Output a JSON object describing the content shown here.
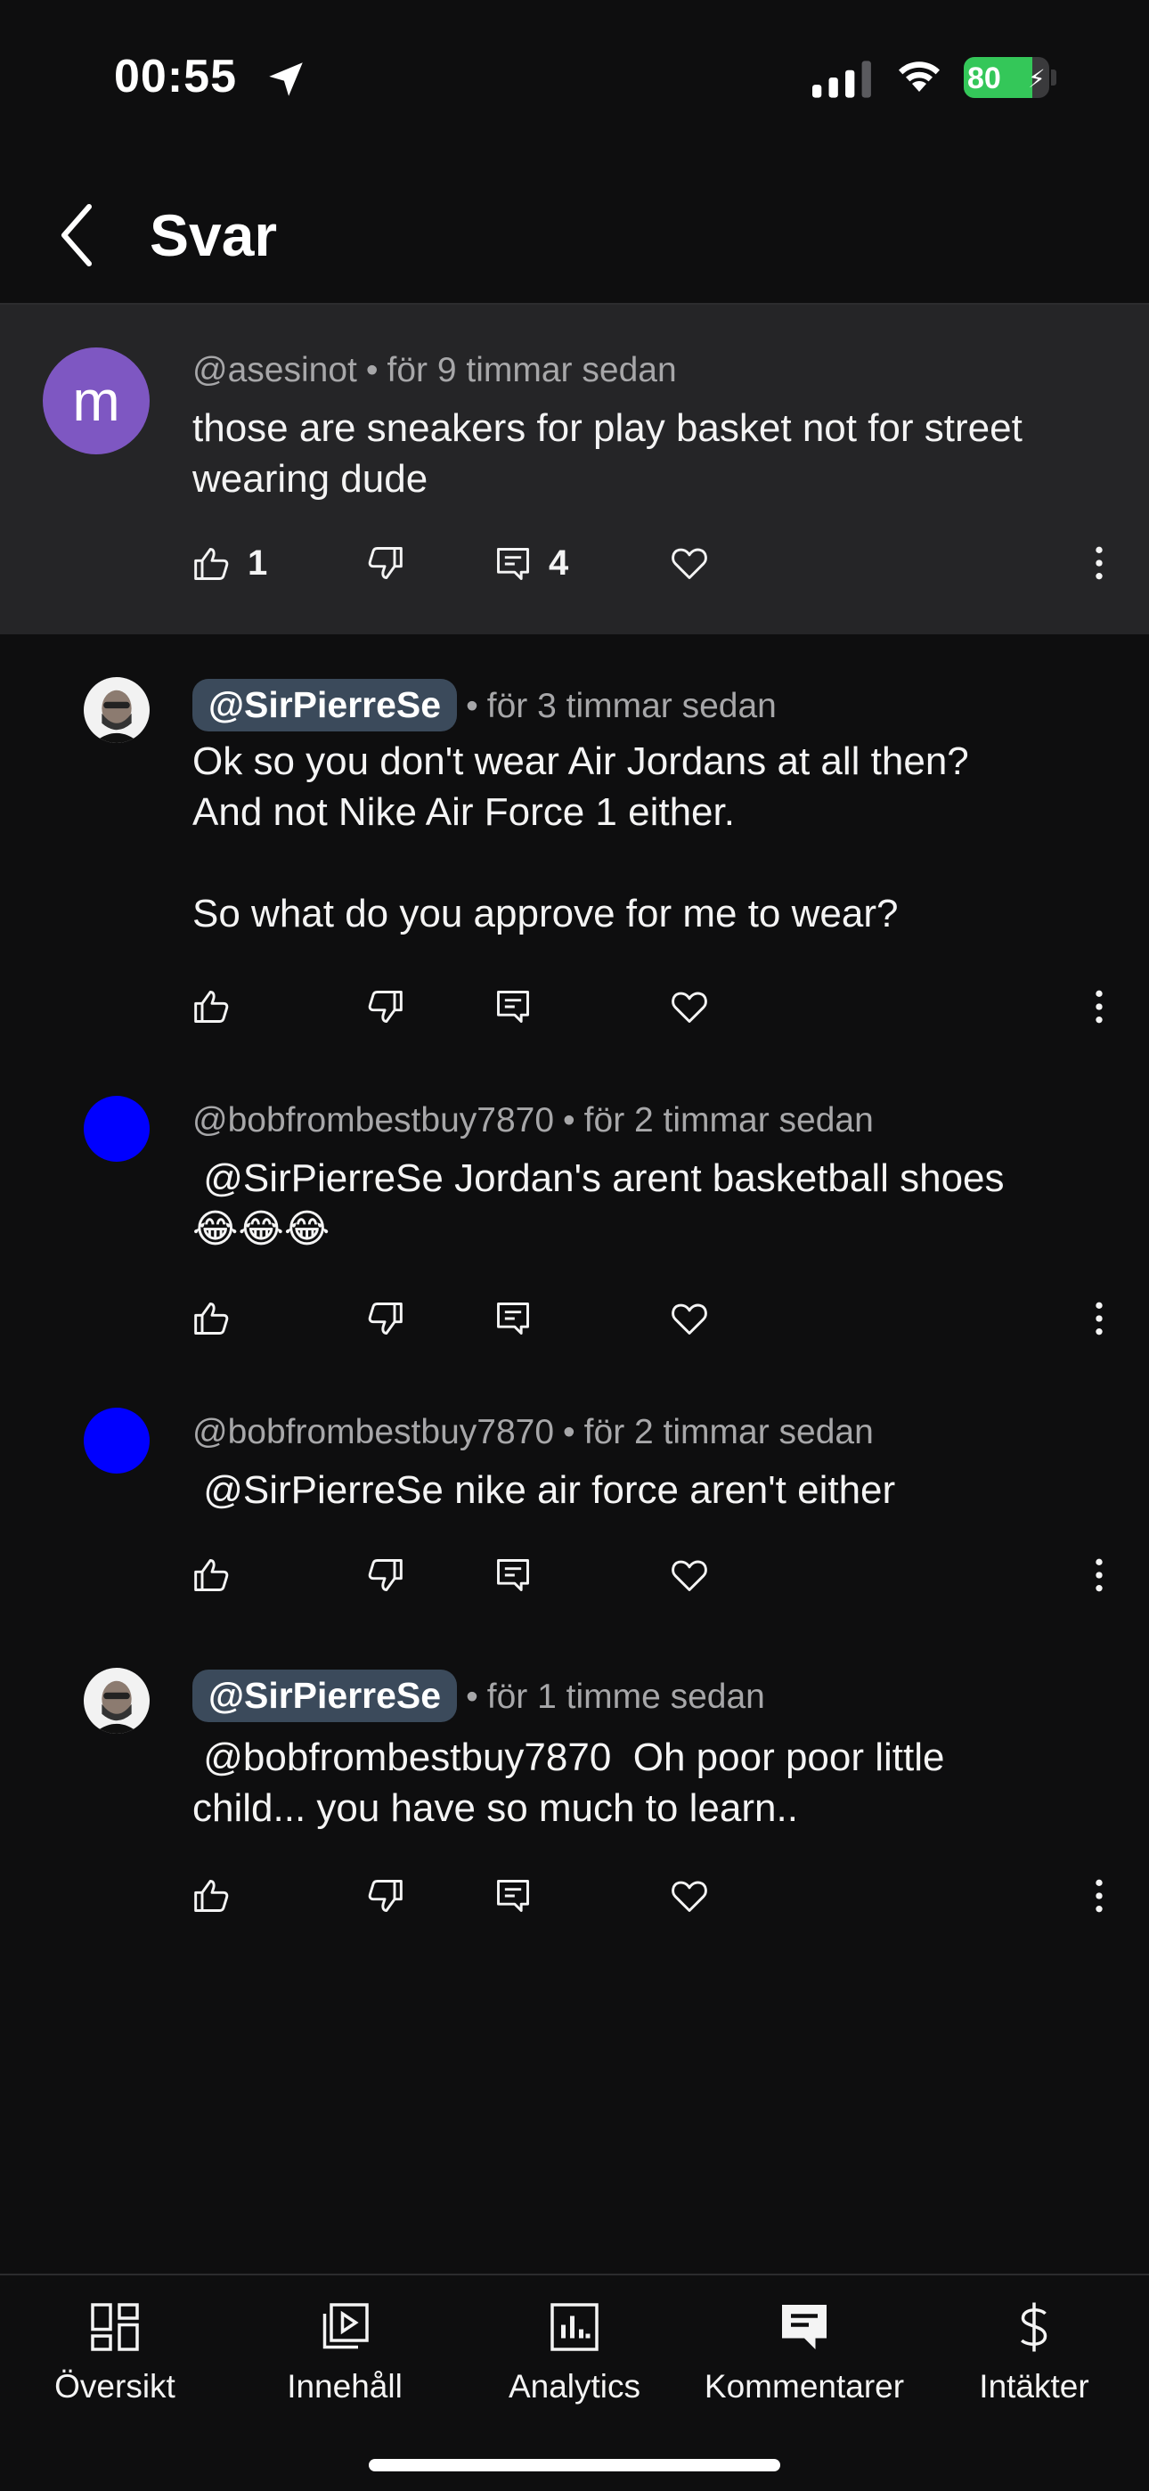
{
  "status_bar": {
    "time": "00:55",
    "battery": "80",
    "battery_level": 80
  },
  "header": {
    "title": "Svar"
  },
  "comments": [
    {
      "handle": "@asesinot",
      "handle_style": "plain",
      "avatar": {
        "type": "letter",
        "letter": "m",
        "color": "#7e57c2"
      },
      "time": "för 9 timmar sedan",
      "text": "those are sneakers for play basket not for street wearing dude",
      "likes": "1",
      "replies": "4"
    },
    {
      "handle": "@SirPierreSe",
      "handle_style": "chip",
      "avatar": {
        "type": "photo"
      },
      "time": "för 3 timmar sedan",
      "text": "Ok so you don't wear Air Jordans at all then?\nAnd not Nike Air Force 1 either.\n\nSo what do you approve for me to wear?"
    },
    {
      "handle": "@bobfrombestbuy7870",
      "handle_style": "plain",
      "avatar": {
        "type": "solid",
        "color": "#0000ff"
      },
      "time": "för 2 timmar sedan",
      "text": " @SirPierreSe Jordan's arent basketball shoes\n😂😂😂"
    },
    {
      "handle": "@bobfrombestbuy7870",
      "handle_style": "plain",
      "avatar": {
        "type": "solid",
        "color": "#0000ff"
      },
      "time": "för 2 timmar sedan",
      "text": " @SirPierreSe nike air force aren't either"
    },
    {
      "handle": "@SirPierreSe",
      "handle_style": "chip",
      "avatar": {
        "type": "photo"
      },
      "time": "för 1 timme sedan",
      "text": " @bobfrombestbuy7870  Oh poor poor little\nchild... you have so much to learn.."
    }
  ],
  "nav": [
    {
      "label": "Översikt",
      "icon": "dashboard-icon"
    },
    {
      "label": "Innehåll",
      "icon": "content-icon"
    },
    {
      "label": "Analytics",
      "icon": "analytics-icon"
    },
    {
      "label": "Kommentarer",
      "icon": "comments-icon"
    },
    {
      "label": "Intäkter",
      "icon": "dollar-icon"
    }
  ],
  "colors": {
    "background": "#0e0e0f",
    "highlight": "#252527",
    "chip": "#3b4a5b",
    "battery": "#34c759"
  }
}
